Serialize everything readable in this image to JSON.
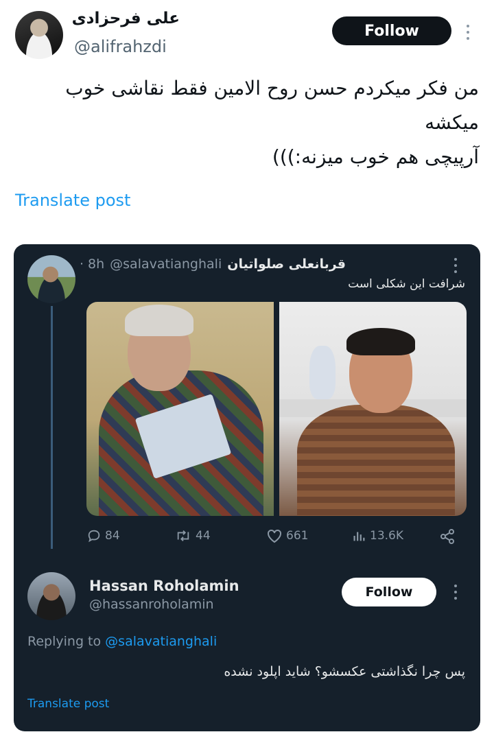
{
  "outer": {
    "name": "علی فرحزادی",
    "handle": "@alifrahzdi",
    "follow_label": "Follow",
    "text": "من فکر میکردم حسن روح الامین فقط نقاشی خوب میکشه\nآرپیچی هم خوب میزنه:)))",
    "translate_label": "Translate post"
  },
  "quoted": {
    "name": "قربانعلی صلواتیان",
    "handle": "@salavatianghali",
    "time": "· 8h",
    "text": "شرافت این شکلی است",
    "stats": {
      "replies": "84",
      "reposts": "44",
      "likes": "661",
      "views": "13.6K"
    },
    "icons": [
      "reply-icon",
      "repost-icon",
      "like-icon",
      "views-icon",
      "share-icon"
    ]
  },
  "reply": {
    "name": "Hassan Roholamin",
    "handle": "@hassanroholamin",
    "follow_label": "Follow",
    "replying_prefix": "Replying to",
    "replying_mention": "@salavatianghali",
    "text": "پس چرا نگذاشتی عکسشو؟ شاید اپلود نشده",
    "translate_label": "Translate post"
  },
  "colors": {
    "accent": "#1d9bf0",
    "card_bg": "#15202b",
    "text_primary": "#0f1419",
    "text_secondary": "#536471"
  }
}
